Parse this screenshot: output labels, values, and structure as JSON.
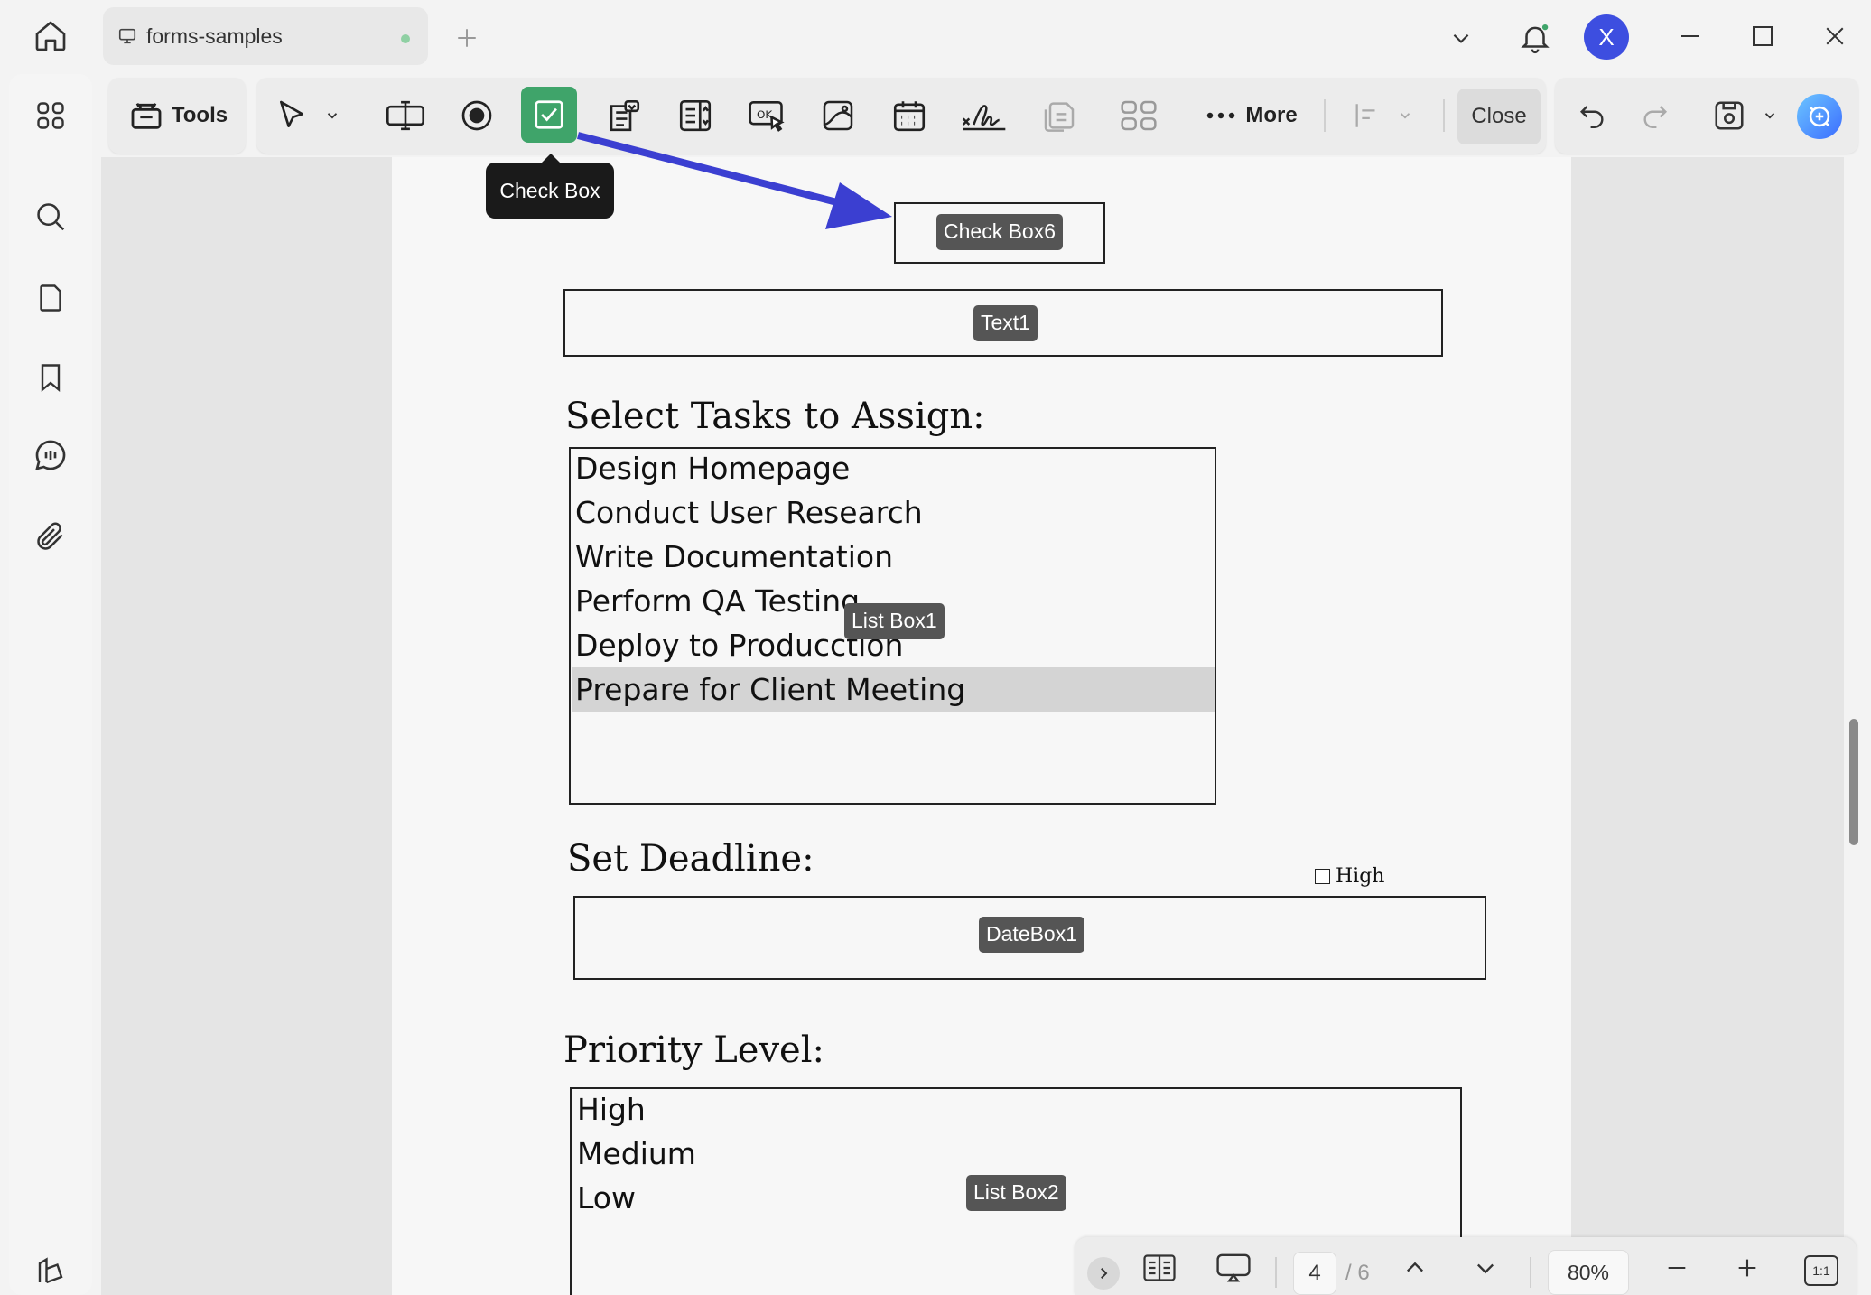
{
  "window": {
    "tab_title": "forms-samples",
    "avatar_letter": "X"
  },
  "toolbar": {
    "tools_label": "Tools",
    "more_label": "More",
    "close_label": "Close",
    "selected_tool": "check-box-tool",
    "tooltip": "Check Box"
  },
  "form": {
    "checkbox_label": "Check Box6",
    "text_label": "Text1",
    "tasks_heading": "Select Tasks to Assign:",
    "tasks_items": [
      "Design Homepage",
      "Conduct User Research",
      "Write Documentation",
      "Perform QA Testing",
      "Deploy to Producction",
      "Prepare for Client Meeting"
    ],
    "tasks_selected_index": 5,
    "listbox1_label": "List Box1",
    "deadline_heading": "Set Deadline:",
    "high_checkbox_text": "High",
    "datebox_label": "DateBox1",
    "priority_heading": "Priority Level:",
    "priority_items": [
      "High",
      "Medium",
      "Low"
    ],
    "listbox2_label": "List Box2"
  },
  "bottom_nav": {
    "current_page": "4",
    "total_pages": "/ 6",
    "zoom": "80%",
    "fit_label": "1:1"
  },
  "colors": {
    "accent_green": "#3fa46a",
    "arrow_blue": "#3b3fd1",
    "field_label_bg": "#555555"
  }
}
